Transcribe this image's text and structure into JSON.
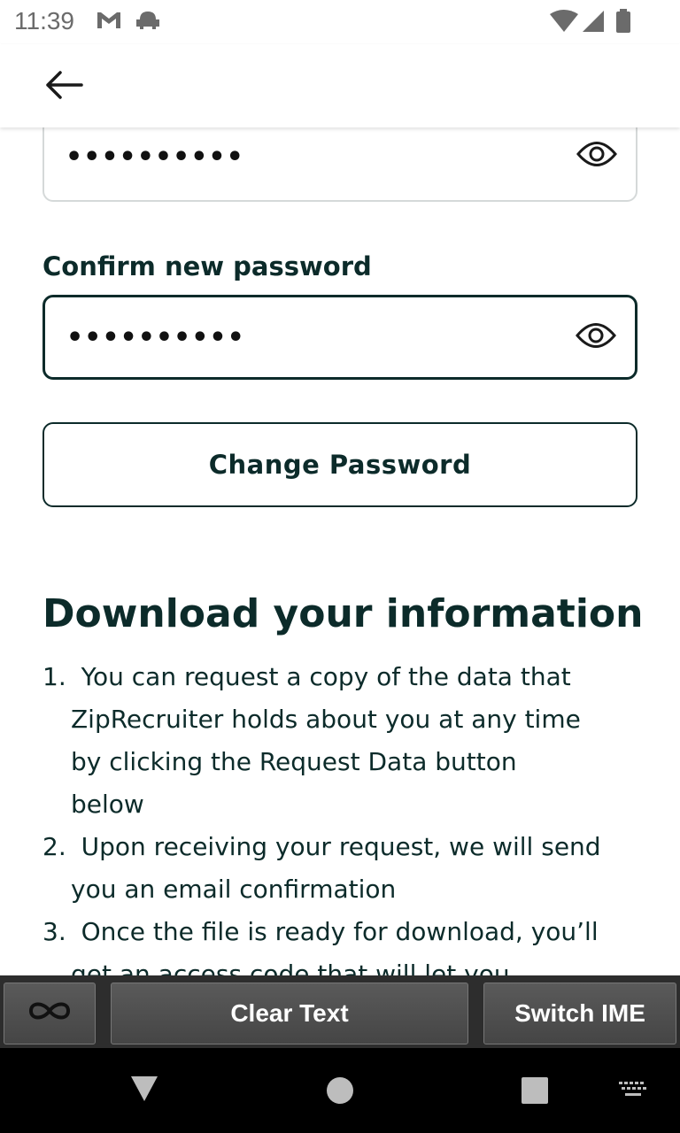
{
  "status_bar": {
    "time": "11:39",
    "icons": [
      "gmail-icon",
      "android-debug-icon",
      "wifi-icon",
      "signal-icon",
      "battery-icon"
    ]
  },
  "app_bar": {
    "back_icon": "arrow-left-icon"
  },
  "form": {
    "new_password_value": "••••••••••",
    "confirm_label": "Confirm new password",
    "confirm_password_value": "••••••••••",
    "show_icon": "eye-icon",
    "change_button_label": "Change Password"
  },
  "download": {
    "title": "Download your information",
    "steps": [
      {
        "num": "1.",
        "first": "You can request a copy of the data that",
        "rest": [
          "ZipRecruiter holds about you at any time",
          "by clicking the Request Data button",
          "below"
        ]
      },
      {
        "num": "2.",
        "first": "Upon receiving your request, we will send",
        "rest": [
          "you an email confirmation"
        ]
      },
      {
        "num": "3.",
        "first": "Once the file is ready for download, you’ll",
        "rest": [
          "get an access code that will let you"
        ]
      }
    ]
  },
  "ime_bar": {
    "infinity_icon": "infinity-icon",
    "clear_text_label": "Clear Text",
    "switch_ime_label": "Switch IME"
  },
  "nav_bar": {
    "icons": [
      "back-triangle-icon",
      "home-circle-icon",
      "recents-square-icon",
      "keyboard-icon"
    ]
  },
  "colors": {
    "primary_text": "#0c2b2a",
    "field_border": "#d5d9d9",
    "ime_bar_bg": "#2d2d2d",
    "nav_bar_bg": "#000000"
  }
}
